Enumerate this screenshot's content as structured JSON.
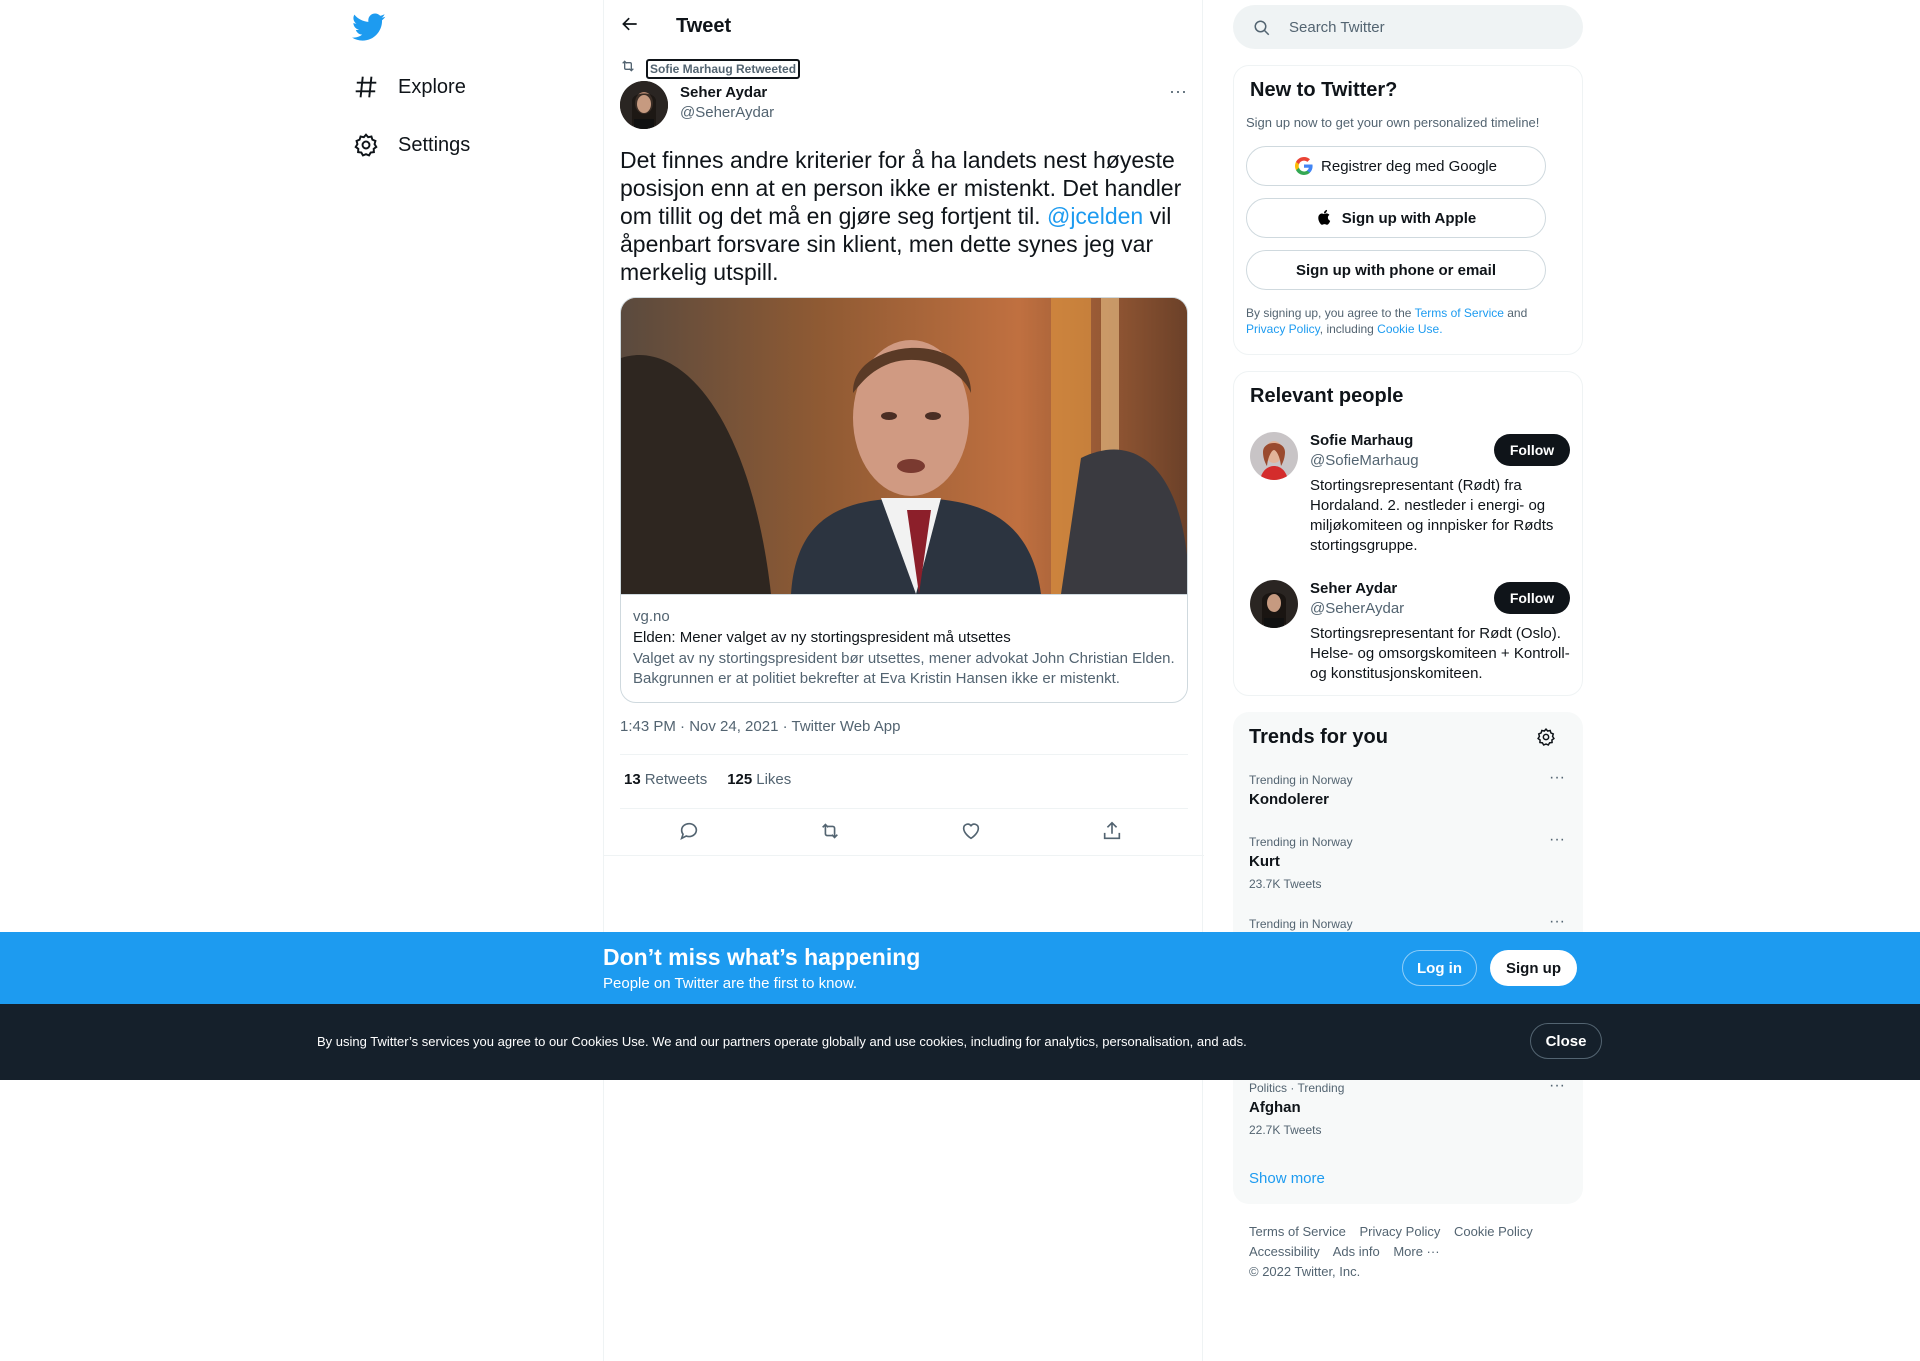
{
  "nav": {
    "logo": "twitter-bird-icon",
    "items": [
      {
        "label": "Explore",
        "icon": "hashtag-icon"
      },
      {
        "label": "Settings",
        "icon": "gear-icon"
      }
    ]
  },
  "header": {
    "title": "Tweet"
  },
  "tweet": {
    "retweeted_by": "Sofie Marhaug Retweeted",
    "author_name": "Seher Aydar",
    "author_handle": "@SeherAydar",
    "text_part1": "Det finnes andre kriterier for å ha landets nest høyeste posisjon enn at en person ikke er mistenkt. Det handler om tillit og det må en gjøre seg fortjent til. ",
    "mention": "@jcelden",
    "text_part2": " vil åpenbart forsvare sin klient, men dette synes jeg var merkelig utspill.",
    "card": {
      "domain": "vg.no",
      "title": "Elden: Mener valget av ny stortingspresident må utsettes",
      "description": "Valget av ny stortingspresident bør utsettes, mener advokat John Christian Elden. Bakgrunnen er at politiet bekrefter at Eva Kristin Hansen ikke er mistenkt."
    },
    "meta": "1:43 PM · Nov 24, 2021 · Twitter Web App",
    "retweets": "13",
    "retweets_label": "Retweets",
    "likes": "125",
    "likes_label": "Likes"
  },
  "search": {
    "placeholder": "Search Twitter"
  },
  "new_to_twitter": {
    "title": "New to Twitter?",
    "subtitle": "Sign up now to get your own personalized timeline!",
    "google_btn": "Registrer deg med Google",
    "apple_btn": "Sign up with Apple",
    "phone_btn": "Sign up with phone or email",
    "legal_prefix": "By signing up, you agree to the ",
    "terms": "Terms of Service",
    "and": " and ",
    "privacy": "Privacy Policy",
    "including": ", including ",
    "cookie": "Cookie Use."
  },
  "relevant_people": {
    "title": "Relevant people",
    "people": [
      {
        "name": "Sofie Marhaug",
        "handle": "@SofieMarhaug",
        "bio": "Stortingsrepresentant (Rødt) fra Hordaland. 2. nestleder i energi- og miljøkomiteen og innpisker for Rødts stortingsgruppe.",
        "follow": "Follow"
      },
      {
        "name": "Seher Aydar",
        "handle": "@SeherAydar",
        "bio": "Stortingsrepresentant for Rødt (Oslo). Helse- og omsorgskomiteen + Kontroll- og konstitusjonskomiteen.",
        "follow": "Follow"
      }
    ]
  },
  "trends": {
    "title": "Trends for you",
    "items": [
      {
        "meta": "Trending in Norway",
        "name": "Kondolerer",
        "count": ""
      },
      {
        "meta": "Trending in Norway",
        "name": "Kurt",
        "count": "23.7K Tweets"
      },
      {
        "meta": "Trending in Norway",
        "name": "",
        "count": ""
      },
      {
        "meta": "Politics · Trending",
        "name": "Afghan",
        "count": "22.7K Tweets"
      }
    ],
    "show_more": "Show more"
  },
  "footer": {
    "links": [
      "Terms of Service",
      "Privacy Policy",
      "Cookie Policy",
      "Accessibility",
      "Ads info",
      "More ···"
    ],
    "copyright": "© 2022 Twitter, Inc."
  },
  "signup_bar": {
    "title": "Don’t miss what’s happening",
    "subtitle": "People on Twitter are the first to know.",
    "login": "Log in",
    "signup": "Sign up"
  },
  "cookie_bar": {
    "text": "By using Twitter’s services you agree to our Cookies Use. We and our partners operate globally and use cookies, including for analytics, personalisation, and ads.",
    "close": "Close"
  },
  "colors": {
    "accent": "#1d9bf0",
    "text": "#0f1419",
    "muted": "#536471",
    "cookie_bg": "#15202b"
  }
}
